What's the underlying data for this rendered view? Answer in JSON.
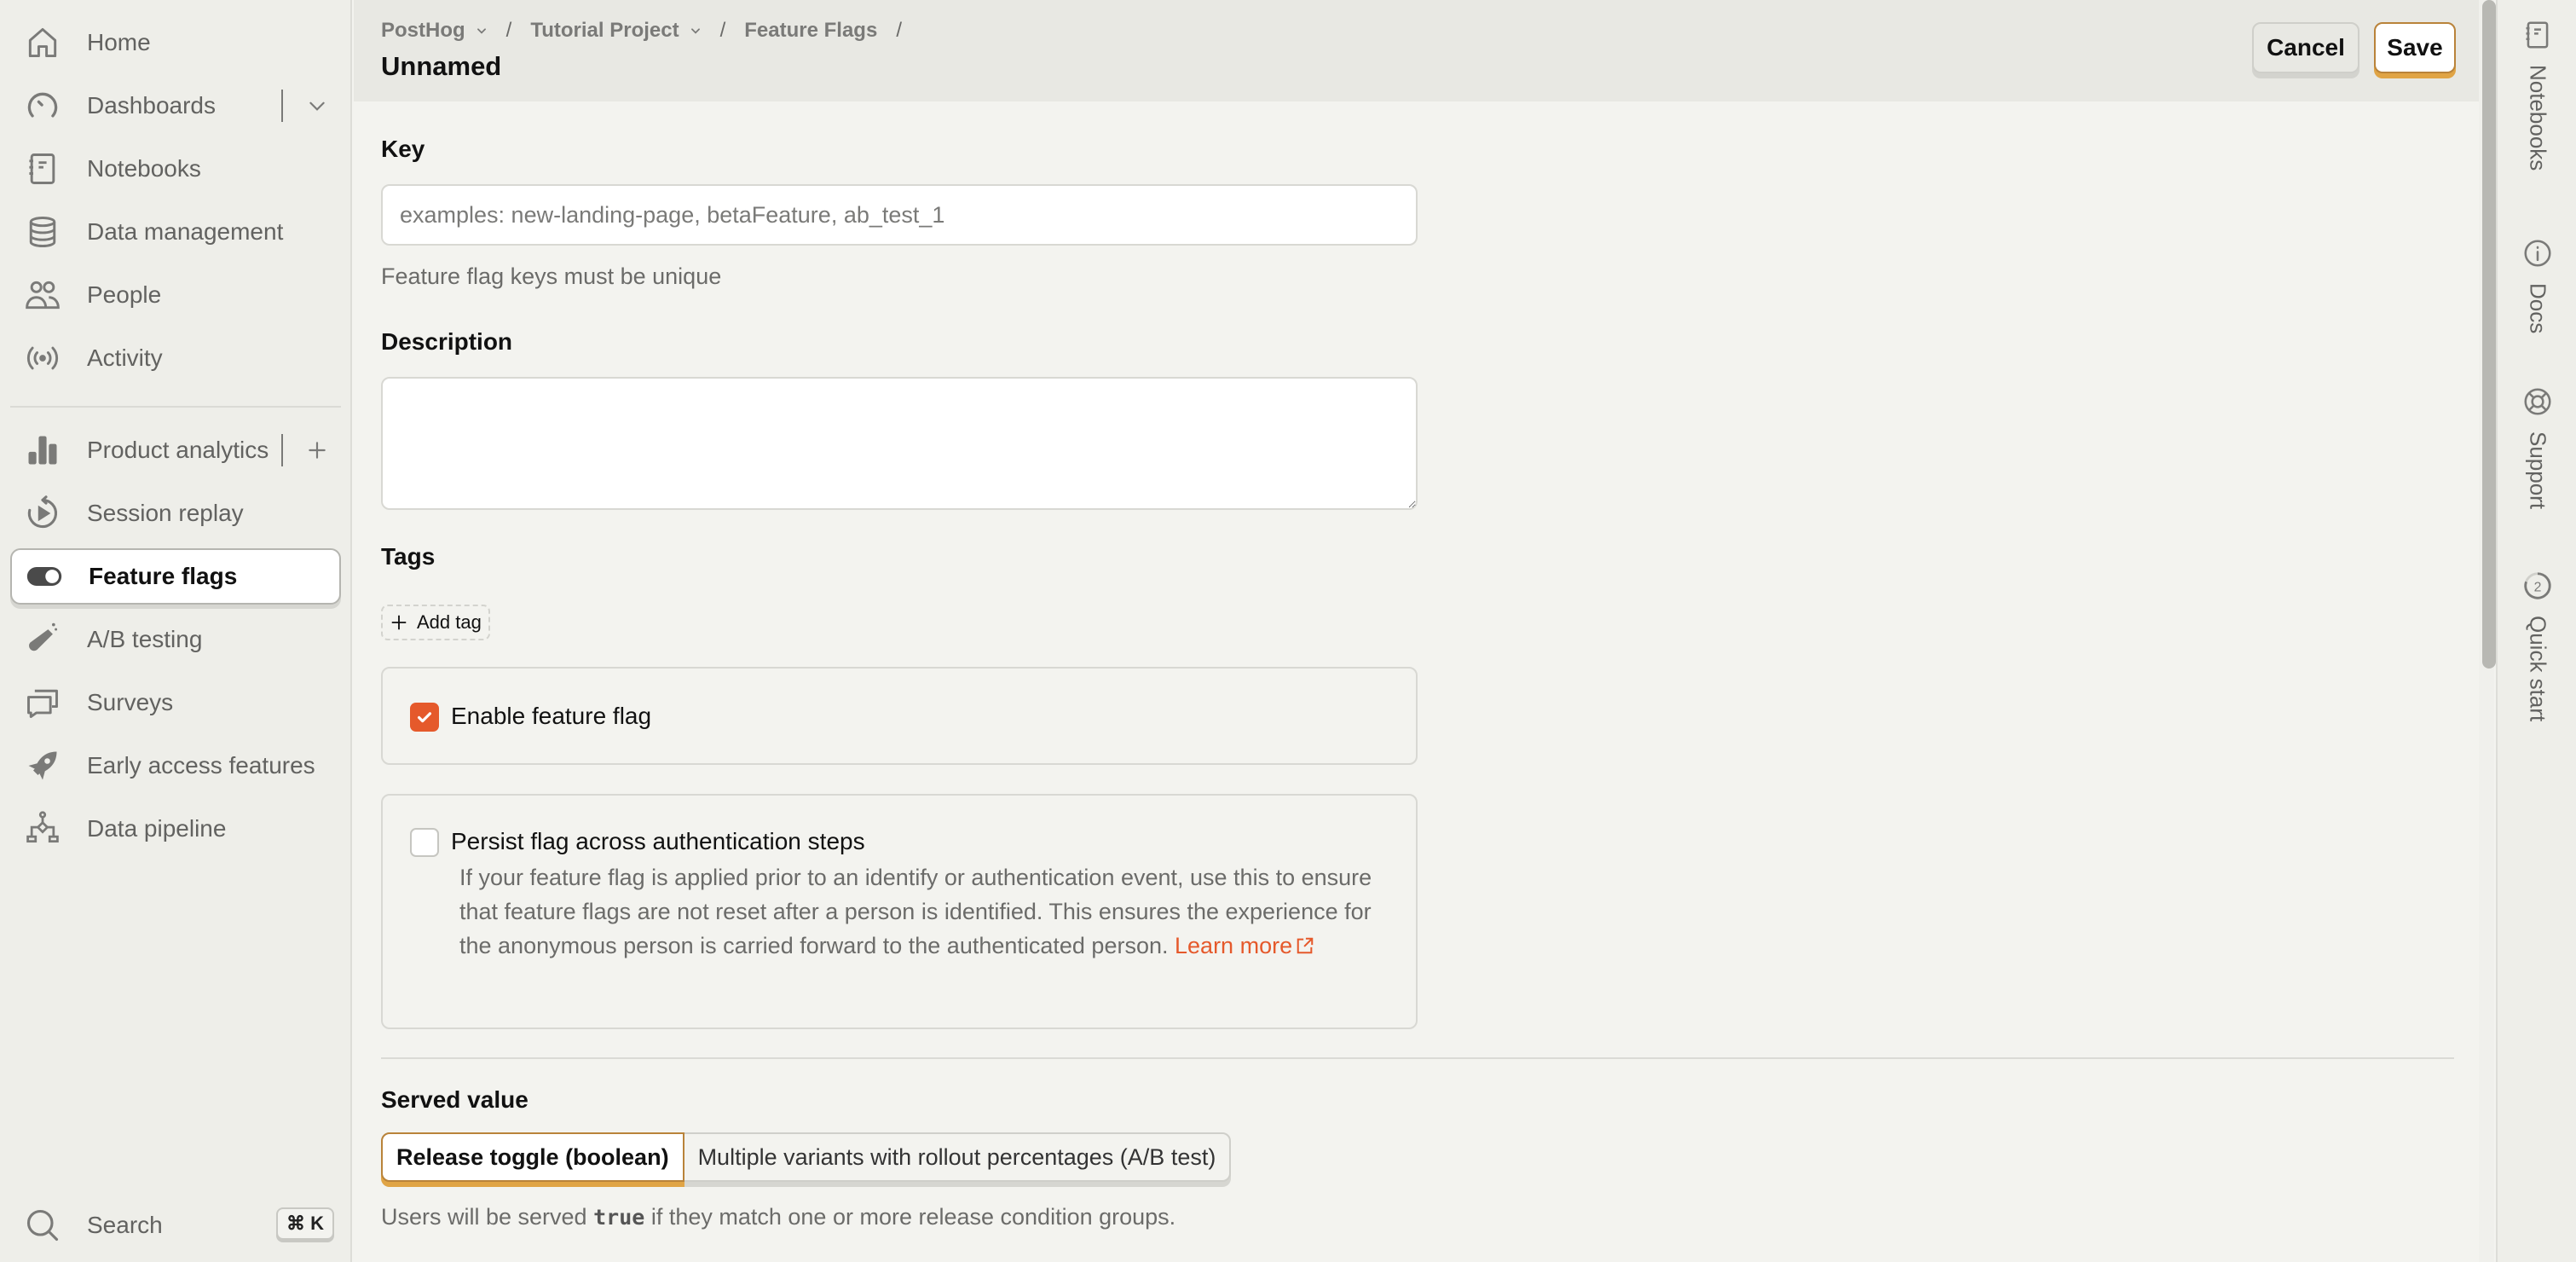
{
  "sidebar": {
    "items": [
      {
        "label": "Home",
        "icon": "home-icon"
      },
      {
        "label": "Dashboards",
        "icon": "dashboard-gauge-icon",
        "action_icon": "chevron-down-icon"
      },
      {
        "label": "Notebooks",
        "icon": "notebook-icon"
      },
      {
        "label": "Data management",
        "icon": "database-icon"
      },
      {
        "label": "People",
        "icon": "people-icon"
      },
      {
        "label": "Activity",
        "icon": "activity-broadcast-icon"
      },
      {
        "label": "Product analytics",
        "icon": "bar-chart-icon",
        "action_icon": "plus-icon"
      },
      {
        "label": "Session replay",
        "icon": "session-replay-icon"
      },
      {
        "label": "Feature flags",
        "icon": "toggle-icon",
        "active": true
      },
      {
        "label": "A/B testing",
        "icon": "flask-icon"
      },
      {
        "label": "Surveys",
        "icon": "chat-bubbles-icon"
      },
      {
        "label": "Early access features",
        "icon": "rocket-icon"
      },
      {
        "label": "Data pipeline",
        "icon": "pipeline-icon"
      }
    ],
    "search": {
      "label": "Search",
      "shortcut": "⌘ K"
    }
  },
  "header": {
    "breadcrumbs": [
      {
        "label": "PostHog",
        "has_dropdown": true
      },
      {
        "label": "Tutorial Project",
        "has_dropdown": true
      },
      {
        "label": "Feature Flags",
        "has_dropdown": false
      }
    ],
    "separator": "/",
    "title": "Unnamed",
    "cancel_label": "Cancel",
    "save_label": "Save"
  },
  "form": {
    "key": {
      "label": "Key",
      "value": "",
      "placeholder": "examples: new-landing-page, betaFeature, ab_test_1",
      "hint": "Feature flag keys must be unique"
    },
    "description": {
      "label": "Description",
      "value": ""
    },
    "tags": {
      "label": "Tags",
      "add_label": "Add tag"
    },
    "enable_flag": {
      "label": "Enable feature flag",
      "checked": true
    },
    "persist_flag": {
      "label": "Persist flag across authentication steps",
      "checked": false,
      "description": "If your feature flag is applied prior to an identify or authentication event, use this to ensure that feature flags are not reset after a person is identified. This ensures the experience for the anonymous person is carried forward to the authenticated person.",
      "learn_more": "Learn more"
    },
    "served_value": {
      "label": "Served value",
      "options": [
        {
          "label": "Release toggle (boolean)",
          "selected": true
        },
        {
          "label": "Multiple variants with rollout percentages (A/B test)",
          "selected": false
        }
      ],
      "hint_prefix": "Users will be served",
      "hint_code": "true",
      "hint_suffix": "if they match one or more release condition groups."
    }
  },
  "right_sidebar": {
    "items": [
      {
        "label": "Notebooks",
        "icon": "notebook-icon"
      },
      {
        "label": "Docs",
        "icon": "info-icon"
      },
      {
        "label": "Support",
        "icon": "lifebuoy-icon"
      },
      {
        "label": "Quick start",
        "icon": "progress-ring-icon",
        "badge": "2"
      }
    ]
  },
  "colors": {
    "accent": "#E5592B",
    "primary_button_border": "#B9833A",
    "primary_button_shadow": "#E0A445",
    "sidebar_bg": "#EEEEE9",
    "header_bg": "#E8E8E3",
    "content_bg": "#F3F3EF"
  }
}
